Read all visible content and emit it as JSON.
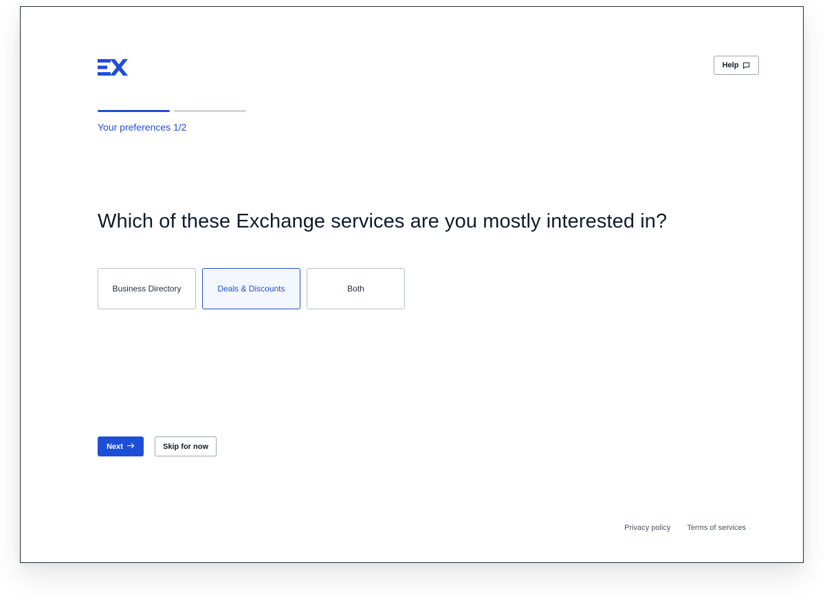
{
  "brand": {
    "logo_text": "EX",
    "color": "#1d4ed8"
  },
  "header": {
    "help_label": "Help",
    "help_icon": "chat-bubble-icon"
  },
  "progress": {
    "current_step": 1,
    "total_steps": 2,
    "active_color": "#1d4ed8",
    "inactive_color": "#d1d5db",
    "label": "Your preferences 1/2"
  },
  "question": {
    "title": "Which of these Exchange services are you mostly interested in?",
    "options": [
      {
        "label": "Business Directory",
        "selected": false
      },
      {
        "label": "Deals & Discounts",
        "selected": true
      },
      {
        "label": "Both",
        "selected": false
      }
    ]
  },
  "actions": {
    "next_label": "Next",
    "next_icon": "arrow-right-icon",
    "skip_label": "Skip for now"
  },
  "footer": {
    "privacy_label": "Privacy policy",
    "terms_label": "Terms of services"
  }
}
